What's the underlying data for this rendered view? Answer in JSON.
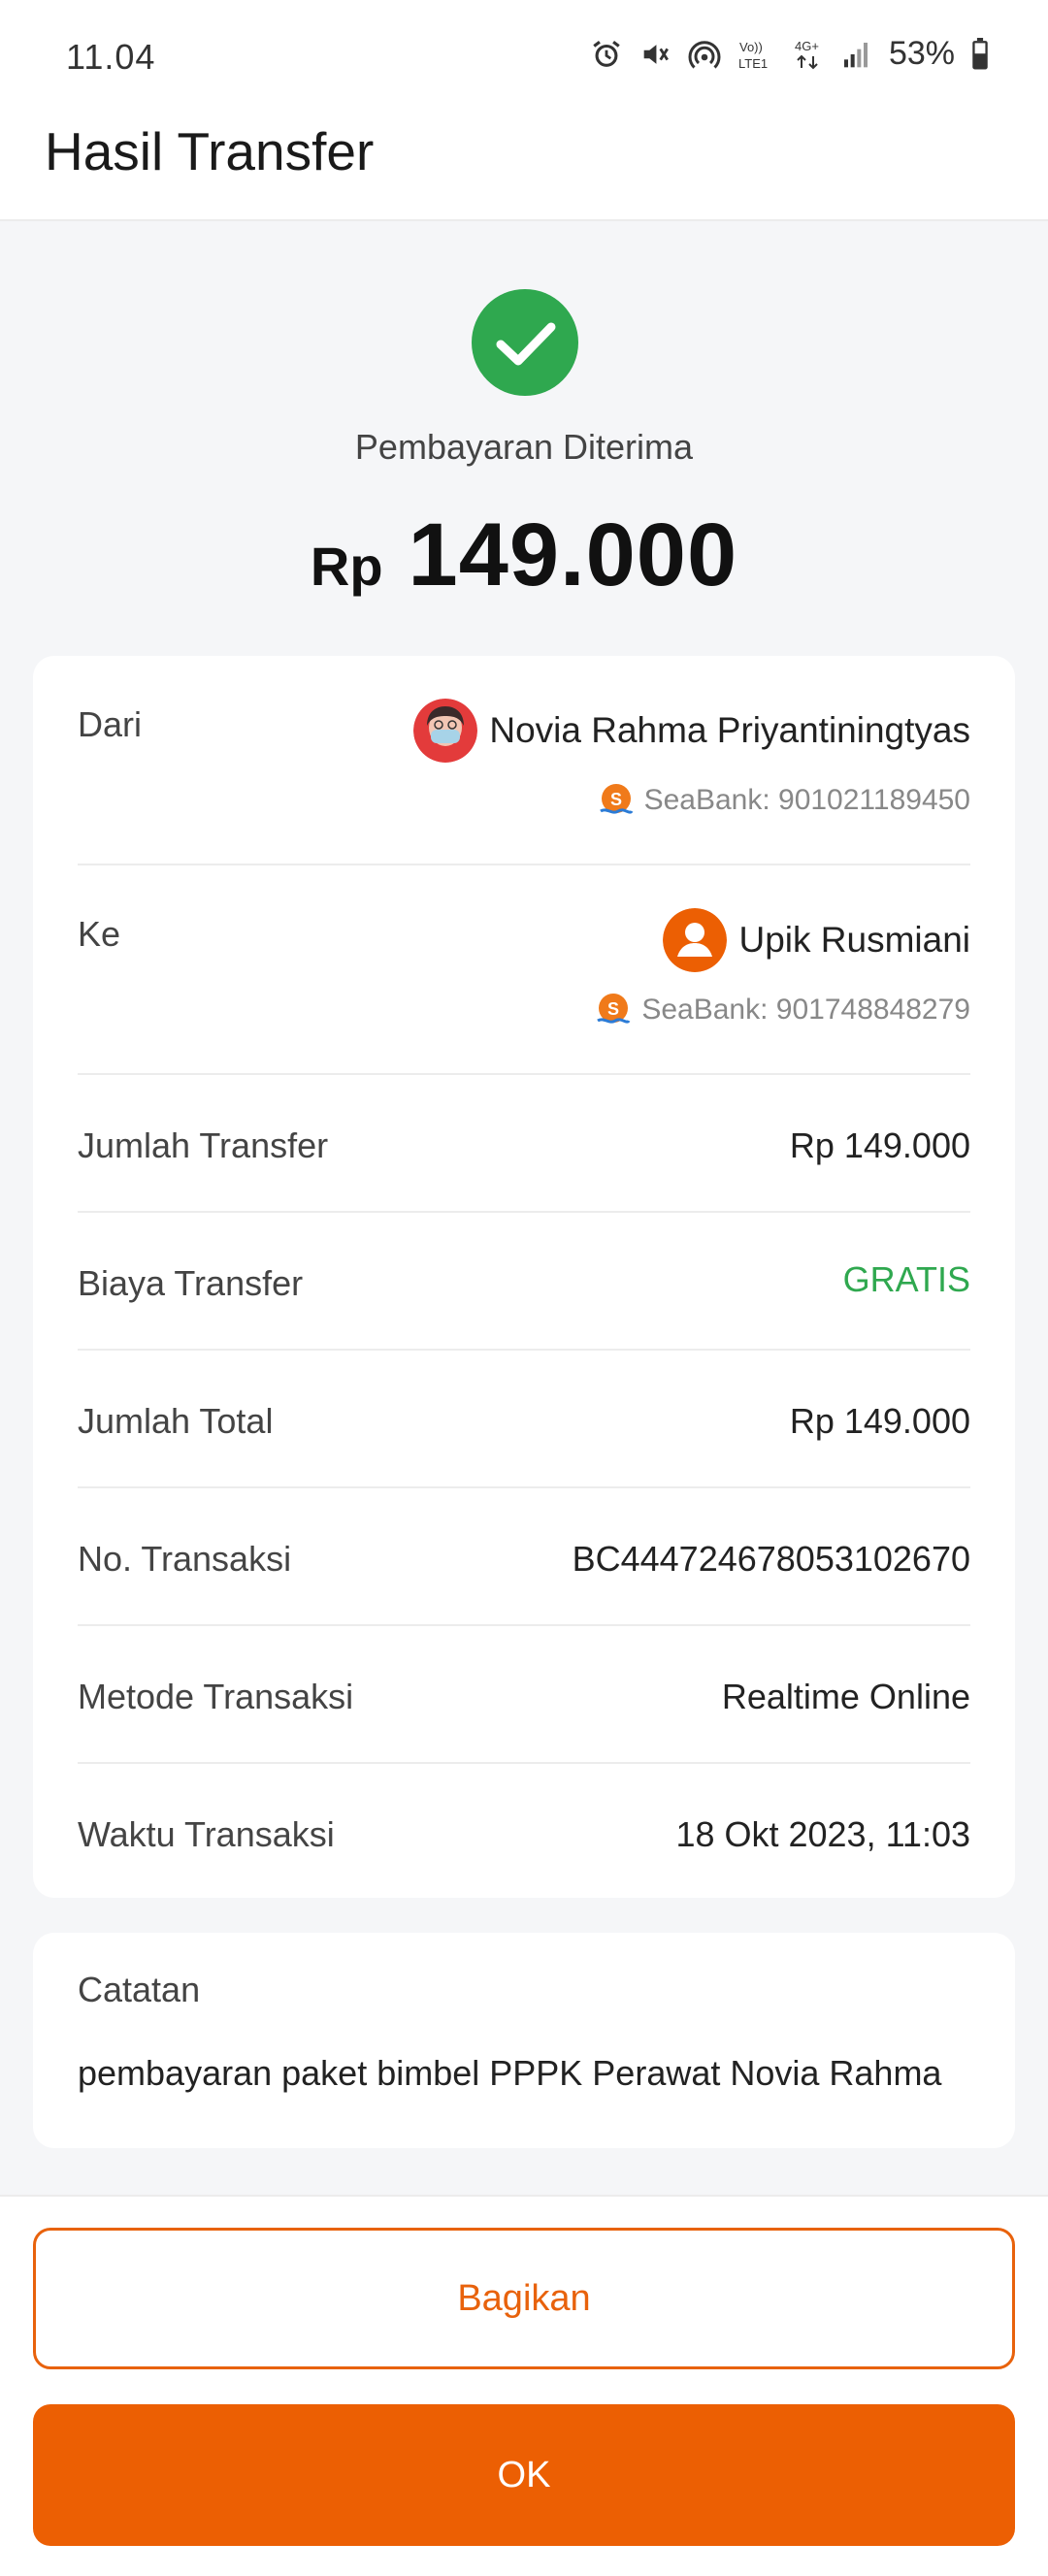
{
  "statusbar": {
    "time": "11.04",
    "battery": "53%",
    "network_label_top": "Vo))",
    "network_label_bottom": "LTE1",
    "net_type": "4G+"
  },
  "header": {
    "title": "Hasil Transfer"
  },
  "result": {
    "status": "Pembayaran Diterima",
    "currency": "Rp",
    "amount": "149.000"
  },
  "from": {
    "label": "Dari",
    "name": "Novia Rahma Priyantiningtyas",
    "bank": "SeaBank: 901021189450"
  },
  "to": {
    "label": "Ke",
    "name": "Upik Rusmiani",
    "bank": "SeaBank: 901748848279"
  },
  "details": [
    {
      "label": "Jumlah Transfer",
      "value": "Rp 149.000"
    },
    {
      "label": "Biaya Transfer",
      "value": "GRATIS"
    },
    {
      "label": "Jumlah Total",
      "value": "Rp 149.000"
    },
    {
      "label": "No. Transaksi",
      "value": "BC444724678053102670"
    },
    {
      "label": "Metode Transaksi",
      "value": "Realtime Online"
    },
    {
      "label": "Waktu Transaksi",
      "value": "18 Okt 2023, 11:03"
    }
  ],
  "note": {
    "label": "Catatan",
    "text": "pembayaran paket bimbel PPPK Perawat Novia Rahma"
  },
  "actions": {
    "share_label": "Bagikan",
    "ok_label": "OK"
  },
  "colors": {
    "accent": "#ec5f03",
    "success": "#2fa84f"
  }
}
